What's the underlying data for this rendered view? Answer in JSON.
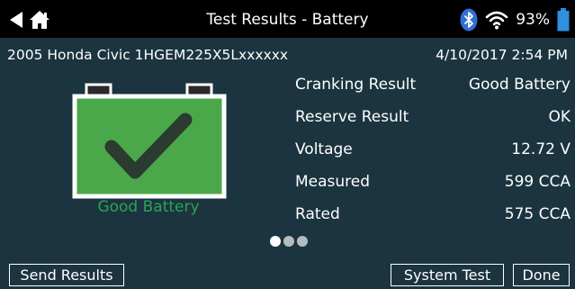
{
  "header": {
    "title": "Test Results - Battery",
    "battery_percent": "93%",
    "icons": [
      "back-arrow-icon",
      "home-icon",
      "bluetooth-icon",
      "wifi-icon",
      "battery-level-icon"
    ]
  },
  "info": {
    "vehicle": "2005 Honda Civic 1HGEM225X5Lxxxxxx",
    "datetime": "4/10/2017  2:54 PM"
  },
  "verdict": {
    "label": "Good Battery",
    "icon": "battery-check-icon",
    "color": "#2ea356"
  },
  "results": [
    {
      "label": "Cranking Result",
      "value": "Good Battery"
    },
    {
      "label": "Reserve Result",
      "value": "OK"
    },
    {
      "label": "Voltage",
      "value": "12.72 V"
    },
    {
      "label": "Measured",
      "value": "599 CCA"
    },
    {
      "label": "Rated",
      "value": "575 CCA"
    }
  ],
  "pager": {
    "pages": 3,
    "current": 1
  },
  "footer": {
    "send_label": "Send Results",
    "system_test_label": "System Test",
    "done_label": "Done"
  },
  "colors": {
    "panel": "#1b3440",
    "accent_green": "#4aa84a",
    "device_battery": "#2f8fe0"
  }
}
